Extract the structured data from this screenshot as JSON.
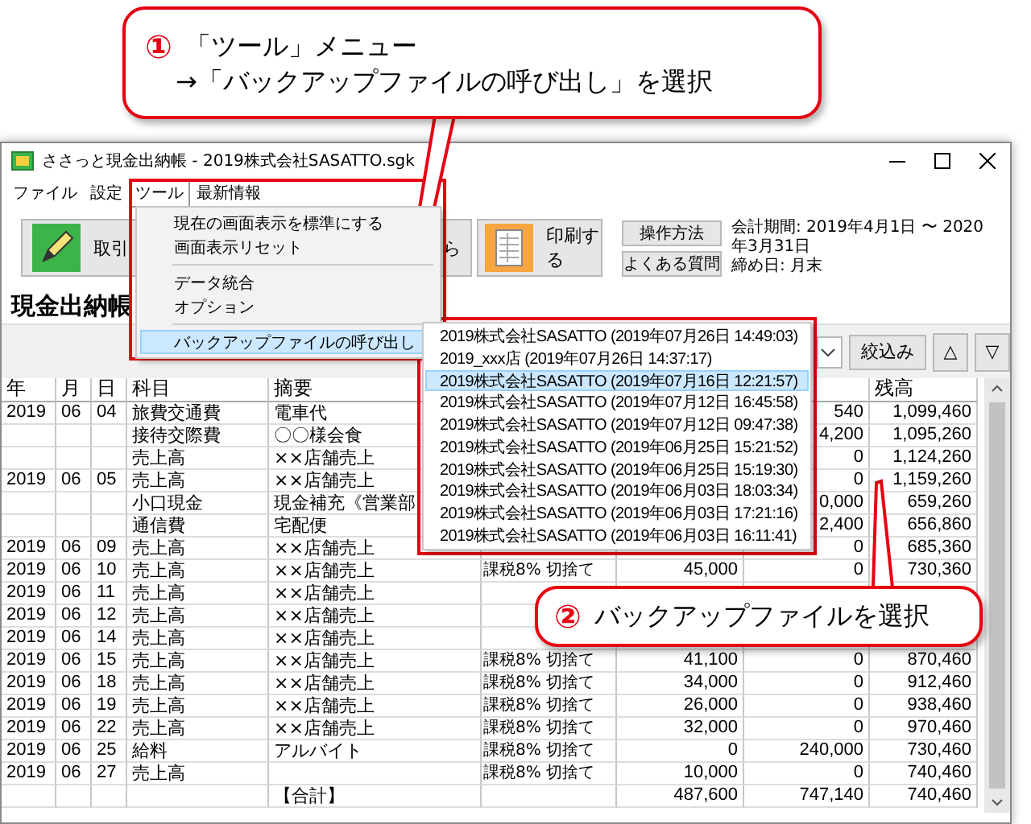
{
  "window": {
    "title": "ささっと現金出納帳 - 2019株式会社SASATTO.sgk"
  },
  "menubar": [
    {
      "label": "ファイル",
      "selected": false
    },
    {
      "label": "設定",
      "selected": false
    },
    {
      "label": "ツール",
      "selected": true
    },
    {
      "label": "最新情報",
      "selected": false
    }
  ],
  "toolbar": {
    "buttons": [
      {
        "label": "取引",
        "kind": "pencil"
      },
      {
        "label": "ら",
        "kind": "plain"
      },
      {
        "label": "印刷する",
        "kind": "print"
      }
    ],
    "help_buttons": [
      "操作方法",
      "よくある質問"
    ],
    "period": "会計期間: 2019年4月1日 〜 2020年3月31日",
    "closing_day": "締め日: 月末"
  },
  "view_title": "現金出納帳",
  "filter": {
    "button": "絞込み",
    "up": "△",
    "down": "▽"
  },
  "table": {
    "columns": [
      "年",
      "月",
      "日",
      "科目",
      "摘要",
      null,
      null,
      null,
      "残高"
    ],
    "rows": [
      [
        "2019",
        "06",
        "04",
        "旅費交通費",
        "電車代",
        null,
        null,
        "540",
        "1,099,460"
      ],
      [
        null,
        null,
        null,
        "接待交際費",
        "〇〇様会食",
        null,
        null,
        "4,200",
        "1,095,260"
      ],
      [
        null,
        null,
        null,
        "売上高",
        "××店舗売上",
        null,
        null,
        "0",
        "1,124,260"
      ],
      [
        "2019",
        "06",
        "05",
        "売上高",
        "××店舗売上",
        null,
        null,
        "0",
        "1,159,260"
      ],
      [
        null,
        null,
        null,
        "小口現金",
        "現金補充《営業部",
        null,
        null,
        "0,000",
        "659,260"
      ],
      [
        null,
        null,
        null,
        "通信費",
        "宅配便",
        null,
        null,
        "2,400",
        "656,860"
      ],
      [
        "2019",
        "06",
        "09",
        "売上高",
        "××店舗売上",
        null,
        null,
        "0",
        "685,360"
      ],
      [
        "2019",
        "06",
        "10",
        "売上高",
        "××店舗売上",
        "課税8% 切捨て",
        "45,000",
        "0",
        "730,360"
      ],
      [
        "2019",
        "06",
        "11",
        "売上高",
        "××店舗売上",
        null,
        null,
        null,
        null
      ],
      [
        "2019",
        "06",
        "12",
        "売上高",
        "××店舗売上",
        null,
        null,
        null,
        null
      ],
      [
        "2019",
        "06",
        "14",
        "売上高",
        "××店舗売上",
        null,
        null,
        null,
        null
      ],
      [
        "2019",
        "06",
        "15",
        "売上高",
        "××店舗売上",
        "課税8% 切捨て",
        "41,100",
        "0",
        "870,460"
      ],
      [
        "2019",
        "06",
        "18",
        "売上高",
        "××店舗売上",
        "課税8% 切捨て",
        "34,000",
        "0",
        "912,460"
      ],
      [
        "2019",
        "06",
        "19",
        "売上高",
        "××店舗売上",
        "課税8% 切捨て",
        "26,000",
        "0",
        "938,460"
      ],
      [
        "2019",
        "06",
        "22",
        "売上高",
        "××店舗売上",
        "課税8% 切捨て",
        "32,000",
        "0",
        "970,460"
      ],
      [
        "2019",
        "06",
        "25",
        "給料",
        "アルバイト",
        "課税8% 切捨て",
        "0",
        "240,000",
        "730,460"
      ],
      [
        "2019",
        "06",
        "27",
        "売上高",
        null,
        "課税8% 切捨て",
        "10,000",
        "0",
        "740,460"
      ],
      [
        null,
        null,
        null,
        null,
        "【合計】",
        null,
        "487,600",
        "747,140",
        "740,460"
      ]
    ]
  },
  "tools_menu": {
    "items": [
      {
        "kind": "item",
        "label": "現在の画面表示を標準にする",
        "selected": false
      },
      {
        "kind": "item",
        "label": "画面表示リセット",
        "selected": false
      },
      {
        "kind": "separator"
      },
      {
        "kind": "item",
        "label": "データ統合",
        "selected": false
      },
      {
        "kind": "item",
        "label": "オプション",
        "selected": false
      },
      {
        "kind": "separator"
      },
      {
        "kind": "submenu",
        "label": "バックアップファイルの呼び出し",
        "selected": true
      }
    ]
  },
  "backup_submenu": {
    "items": [
      {
        "label": "2019株式会社SASATTO (2019年07月26日 14:49:03)",
        "selected": false
      },
      {
        "label": "2019_xxx店 (2019年07月26日 14:37:17)",
        "selected": false
      },
      {
        "label": "2019株式会社SASATTO (2019年07月16日 12:21:57)",
        "selected": true
      },
      {
        "label": "2019株式会社SASATTO (2019年07月12日 16:45:58)",
        "selected": false
      },
      {
        "label": "2019株式会社SASATTO (2019年07月12日 09:47:38)",
        "selected": false
      },
      {
        "label": "2019株式会社SASATTO (2019年06月25日 15:21:52)",
        "selected": false
      },
      {
        "label": "2019株式会社SASATTO (2019年06月25日 15:19:30)",
        "selected": false
      },
      {
        "label": "2019株式会社SASATTO (2019年06月03日 18:03:34)",
        "selected": false
      },
      {
        "label": "2019株式会社SASATTO (2019年06月03日 17:21:16)",
        "selected": false
      },
      {
        "label": "2019株式会社SASATTO (2019年06月03日 16:11:41)",
        "selected": false
      }
    ]
  },
  "callouts": [
    {
      "number": "①",
      "lines": [
        "「ツール」メニュー",
        "→「バックアップファイルの呼び出し」を選択"
      ]
    },
    {
      "number": "②",
      "lines": [
        "バックアップファイルを選択"
      ]
    }
  ]
}
